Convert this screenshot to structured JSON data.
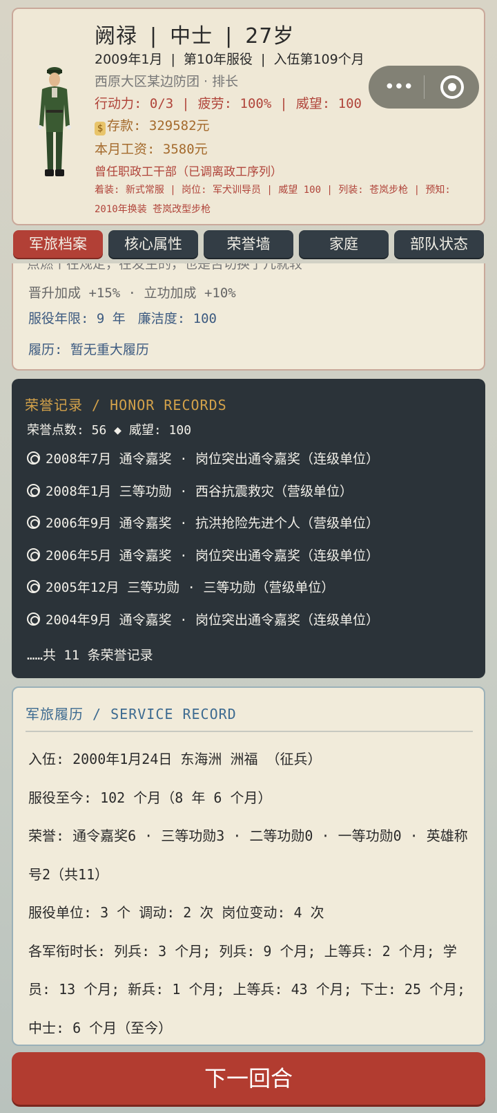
{
  "profile": {
    "name": "阙禄",
    "rank": "中士",
    "age": "27岁",
    "date": "2009年1月",
    "service_year": "第10年服役",
    "enlist_month": "入伍第109个月",
    "unit": "西原大区某边防团 · 排长",
    "action": "行动力: 0/3",
    "fatigue": "疲劳: 100%",
    "prestige": "威望: 100",
    "savings": "存款: 329582元",
    "salary": "本月工资: 3580元",
    "former_post": "曾任职政工干部（已调离政工序列）",
    "equipment": "着装: 新式常服 | 岗位: 军犬训导员 | 威望 100 | 列装: 苍岚步枪 | 预知: 2010年换装 苍岚改型步枪"
  },
  "capsule": {
    "more_icon": "more-dots-icon",
    "close_icon": "target-close-icon"
  },
  "tabs": [
    "军旅档案",
    "核心属性",
    "荣誉墙",
    "家庭",
    "部队状态"
  ],
  "archive": {
    "cut_text": "点燃个在规定，在发生的，也是否切换了几就较",
    "bonus": "晋升加成 +15% · 立功加成 +10%",
    "service_years": "服役年限: 9 年",
    "integrity": "廉洁度: 100",
    "resume": "履历: 暂无重大履历"
  },
  "honor": {
    "title": "荣誉记录 / HONOR RECORDS",
    "summary": "荣誉点数: 56 ◆ 威望: 100",
    "items": [
      "2008年7月 通令嘉奖 · 岗位突出通令嘉奖（连级单位）",
      "2008年1月 三等功勋 · 西谷抗震救灾（营级单位）",
      "2006年9月 通令嘉奖 · 抗洪抢险先进个人（营级单位）",
      "2006年5月 通令嘉奖 · 岗位突出通令嘉奖（连级单位）",
      "2005年12月 三等功勋 · 三等功勋（营级单位）",
      "2004年9月 通令嘉奖 · 岗位突出通令嘉奖（连级单位）"
    ],
    "more": "……共 11 条荣誉记录"
  },
  "service": {
    "title": "军旅履历 / SERVICE RECORD",
    "enlist": "入伍: 2000年1月24日 东海洲 洲福 （征兵）",
    "duration": "服役至今: 102 个月（8 年 6 个月）",
    "honors": "荣誉: 通令嘉奖6 · 三等功勋3 · 二等功勋0 · 一等功勋0 · 英雄称号2（共11）",
    "units": "服役单位: 3 个 调动: 2 次 岗位变动: 4 次",
    "ranks": "各军衔时长: 列兵: 3 个月; 列兵: 9 个月; 上等兵: 2 个月; 学员: 13 个月; 新兵: 1 个月; 上等兵: 43 个月; 下士: 25 个月; 中士: 6 个月（至今）"
  },
  "next_button": "下一回合",
  "colors": {
    "accent_red": "#b23c30",
    "dark_panel": "#2b3339",
    "gold": "#d4a24a",
    "blue_text": "#3c6a90"
  }
}
